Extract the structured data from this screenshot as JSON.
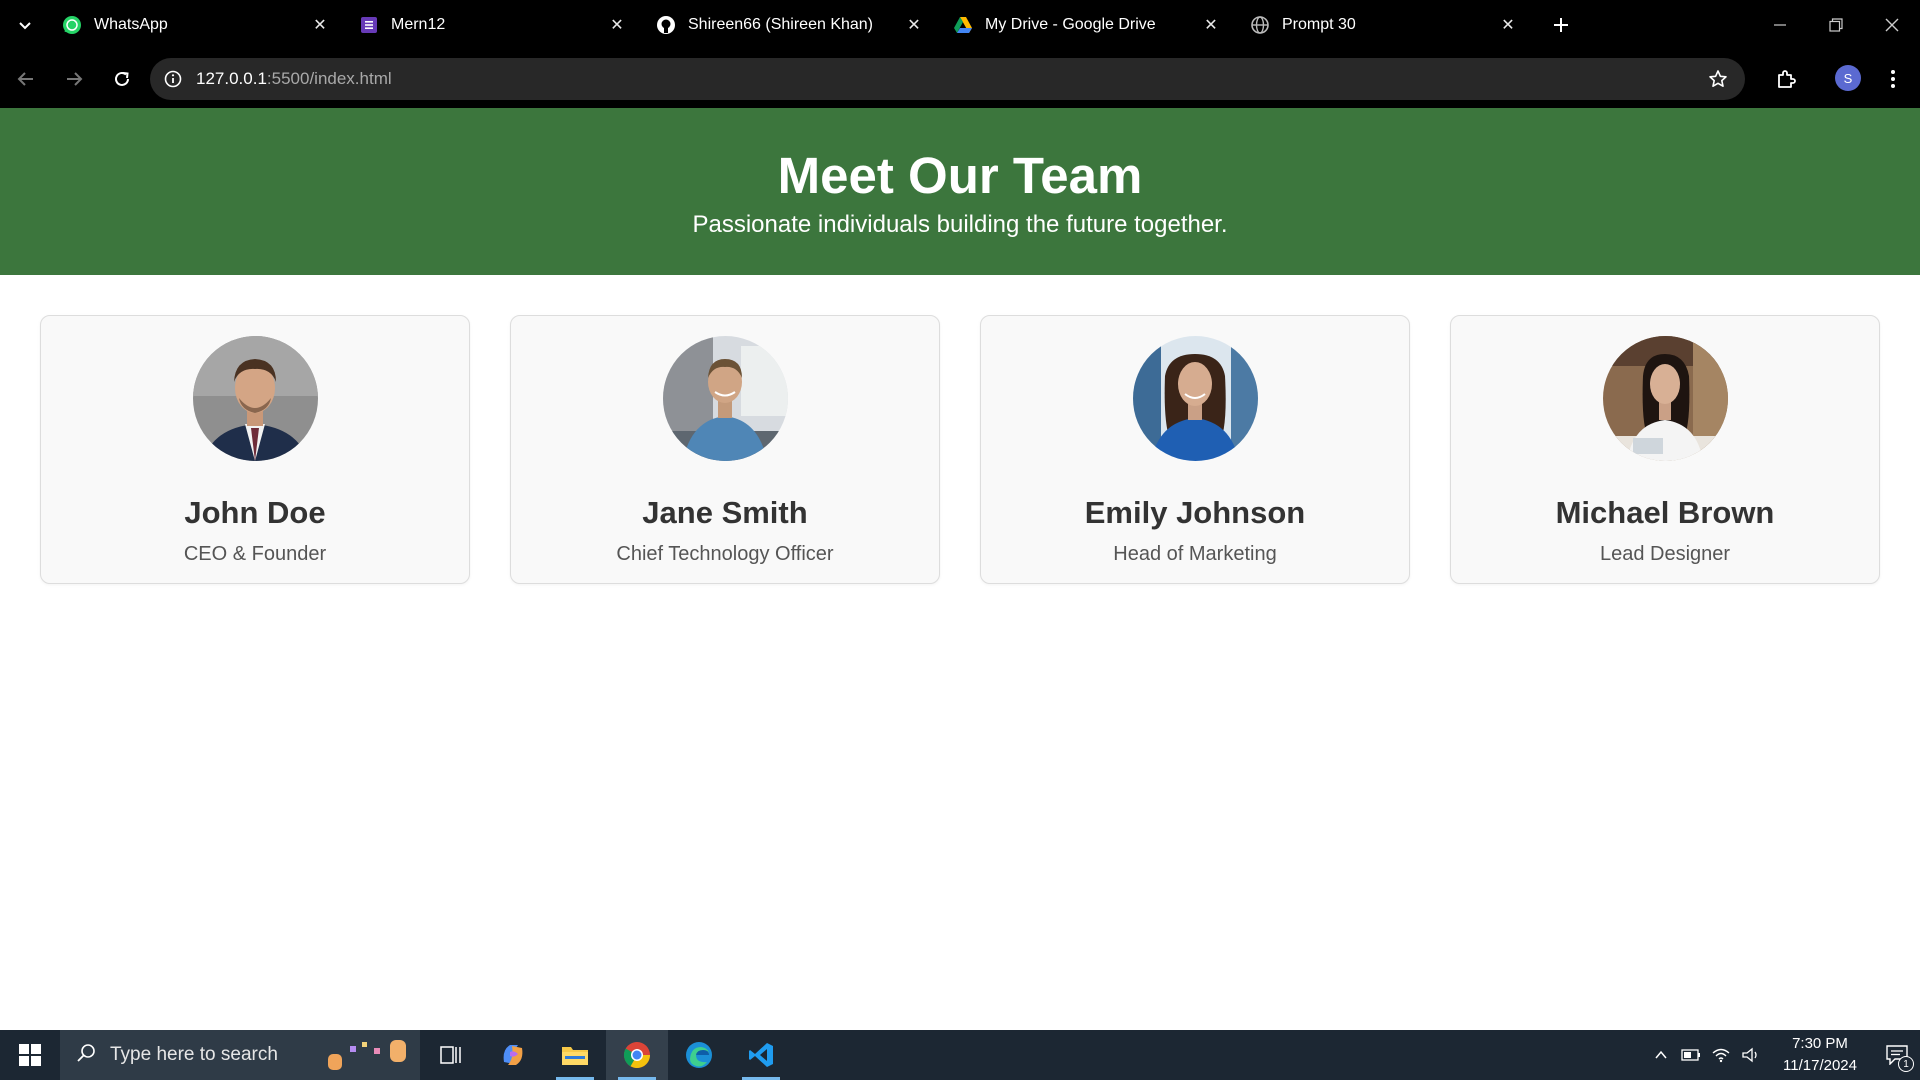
{
  "browser": {
    "tabs": [
      {
        "title": "WhatsApp",
        "icon": "whatsapp-icon"
      },
      {
        "title": "Mern12",
        "icon": "forms-icon"
      },
      {
        "title": "Shireen66 (Shireen Khan)",
        "icon": "github-icon"
      },
      {
        "title": "My Drive - Google Drive",
        "icon": "google-drive-icon"
      },
      {
        "title": "Prompt 30",
        "icon": "globe-icon"
      }
    ],
    "url_host": "127.0.0.1",
    "url_rest": ":5500/index.html",
    "profile_initial": "S"
  },
  "page": {
    "title": "Meet Our Team",
    "subtitle": "Passionate individuals building the future together.",
    "team": [
      {
        "name": "John Doe",
        "role": "CEO & Founder"
      },
      {
        "name": "Jane Smith",
        "role": "Chief Technology Officer"
      },
      {
        "name": "Emily Johnson",
        "role": "Head of Marketing"
      },
      {
        "name": "Michael Brown",
        "role": "Lead Designer"
      }
    ]
  },
  "taskbar": {
    "search_placeholder": "Type here to search",
    "time": "7:30 PM",
    "date": "11/17/2024",
    "notification_count": "1"
  },
  "colors": {
    "header_green": "#3c763d",
    "card_bg": "#f9f9f9"
  }
}
